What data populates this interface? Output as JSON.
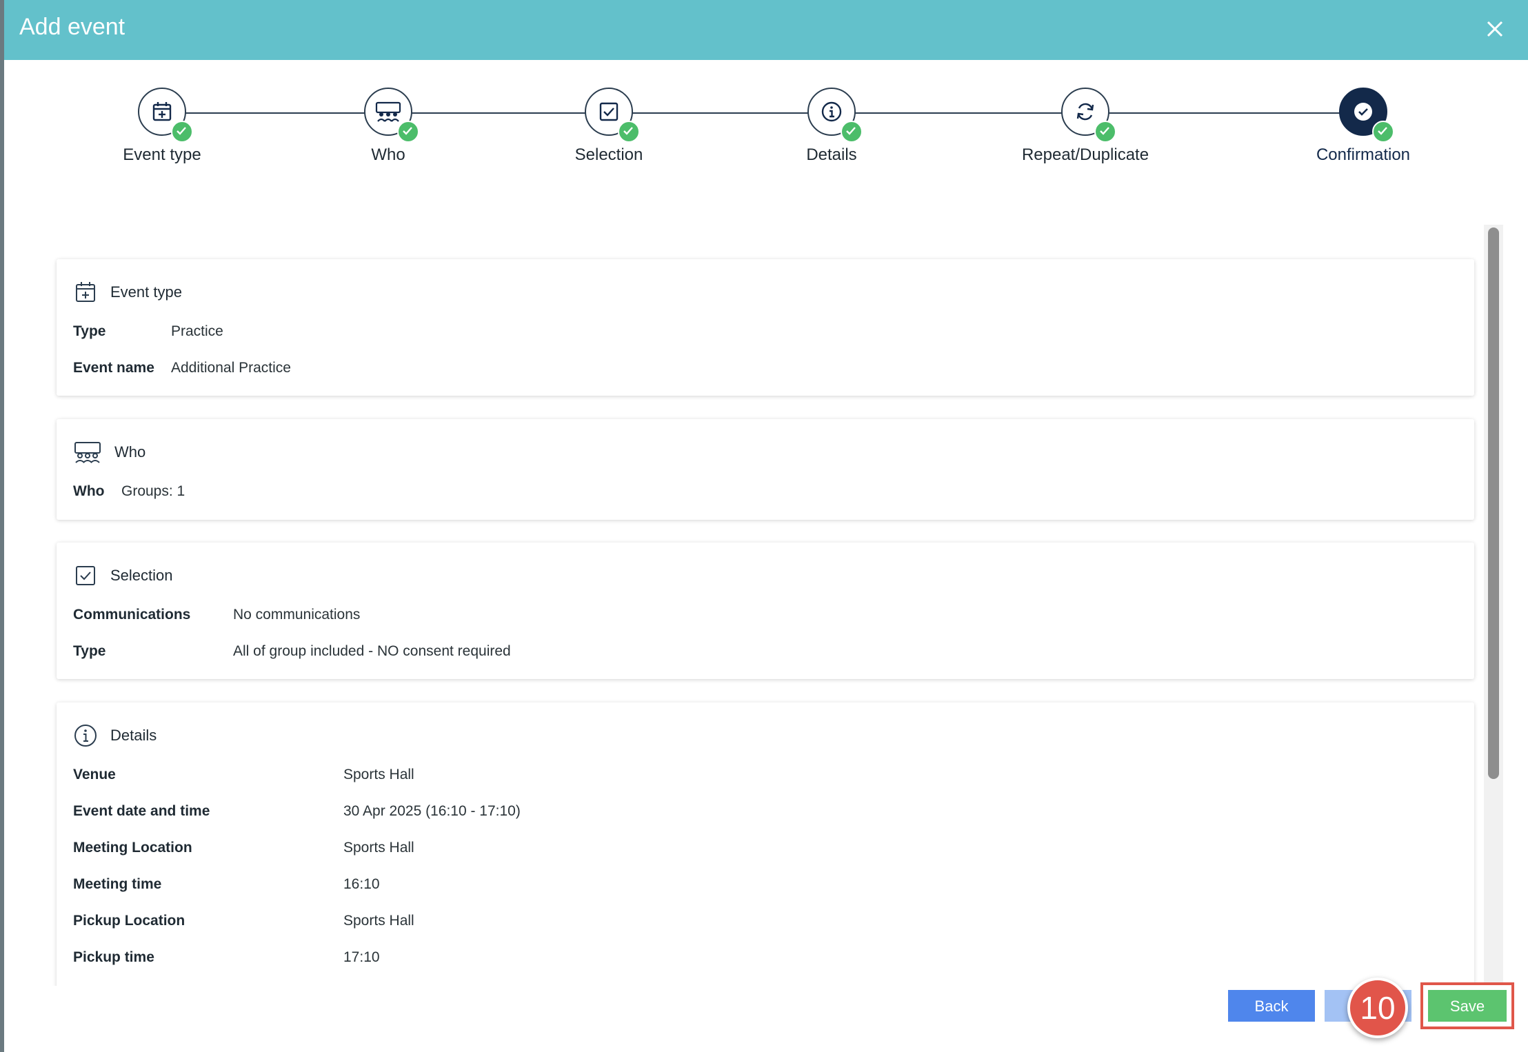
{
  "header": {
    "title": "Add event"
  },
  "steps": [
    {
      "label": "Event type",
      "icon": "calendar-plus-icon",
      "done": true
    },
    {
      "label": "Who",
      "icon": "group-icon",
      "done": true
    },
    {
      "label": "Selection",
      "icon": "checkbox-icon",
      "done": true
    },
    {
      "label": "Details",
      "icon": "info-icon",
      "done": true
    },
    {
      "label": "Repeat/Duplicate",
      "icon": "refresh-icon",
      "done": true
    },
    {
      "label": "Confirmation",
      "icon": "check-circle-icon",
      "done": true,
      "active": true
    }
  ],
  "event_type_card": {
    "title": "Event type",
    "rows": [
      {
        "key": "Type",
        "value": "Practice"
      },
      {
        "key": "Event name",
        "value": "Additional Practice"
      }
    ]
  },
  "who_card": {
    "title": "Who",
    "rows": [
      {
        "key": "Who",
        "value": "Groups: 1"
      }
    ]
  },
  "selection_card": {
    "title": "Selection",
    "rows": [
      {
        "key": "Communications",
        "value": "No communications"
      },
      {
        "key": "Type",
        "value": "All of group included - NO consent required"
      }
    ]
  },
  "details_card": {
    "title": "Details",
    "rows": [
      {
        "key": "Venue",
        "value": "Sports Hall"
      },
      {
        "key": "Event date and time",
        "value": "30 Apr 2025 (16:10 - 17:10)"
      },
      {
        "key": "Meeting Location",
        "value": "Sports Hall"
      },
      {
        "key": "Meeting time",
        "value": "16:10"
      },
      {
        "key": "Pickup Location",
        "value": "Sports Hall"
      },
      {
        "key": "Pickup time",
        "value": "17:10"
      }
    ]
  },
  "footer": {
    "back_label": "Back",
    "next_label": "",
    "save_label": "Save",
    "marker_label": "10"
  },
  "colors": {
    "header": "#63c1cb",
    "check": "#4cbd6a",
    "active_step": "#13294a",
    "back": "#4f86ec",
    "save": "#5cc46f",
    "marker": "#e1554a"
  }
}
